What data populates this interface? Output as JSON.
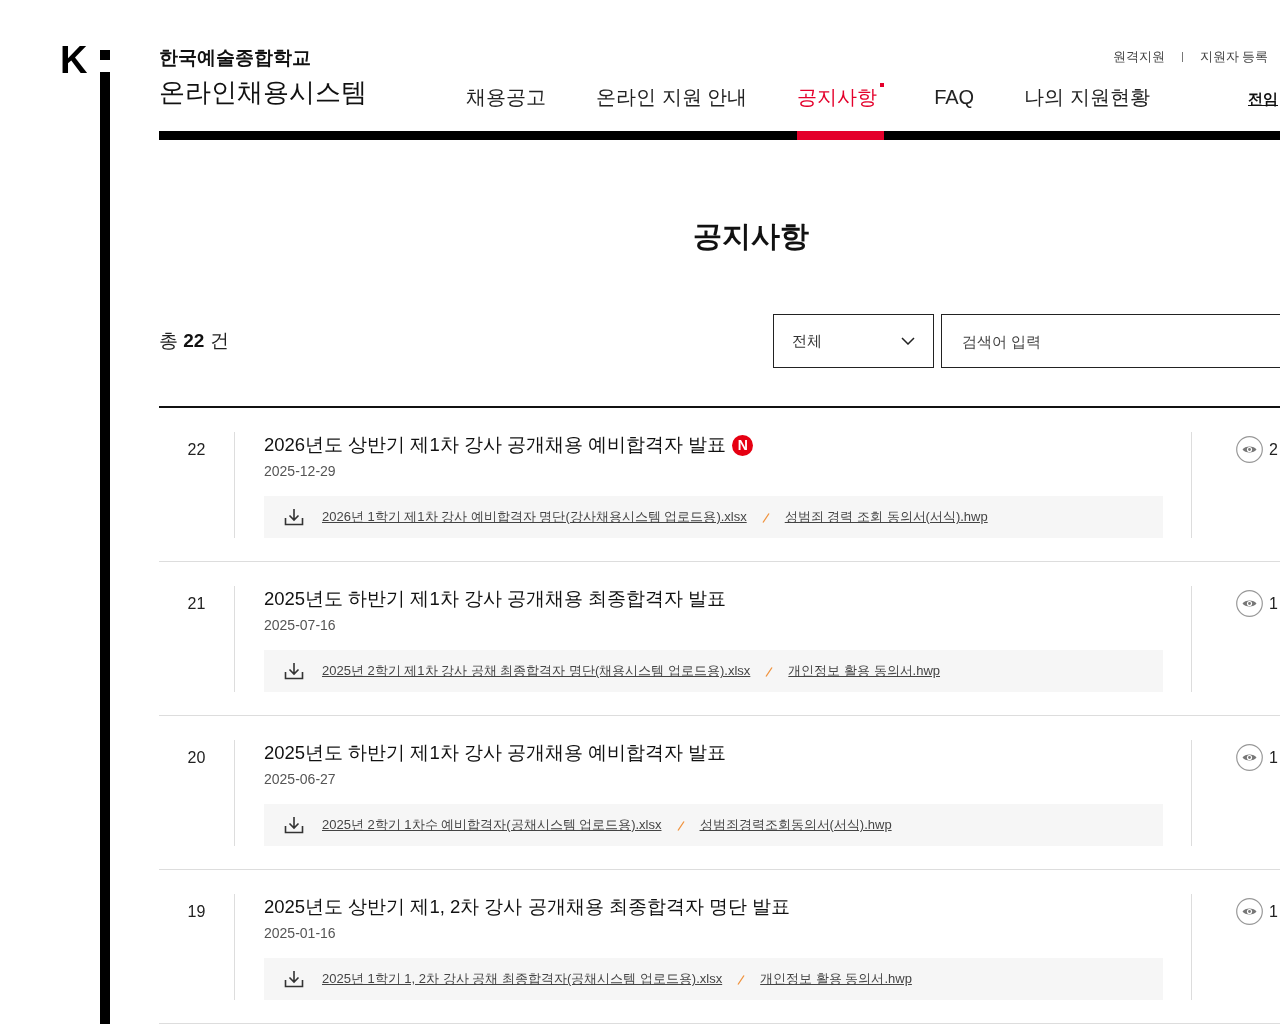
{
  "logo": {
    "mark": "K"
  },
  "brand": {
    "school": "한국예술종합학교",
    "system": "온라인채용시스템"
  },
  "utility_links": [
    "원격지원",
    "지원자 등록"
  ],
  "nav": [
    {
      "label": "채용공고",
      "kind": "menu",
      "selected": false
    },
    {
      "label": "온라인 지원 안내",
      "kind": "menu",
      "selected": false
    },
    {
      "label": "공지사항",
      "kind": "menu",
      "selected": true
    },
    {
      "label": "FAQ",
      "kind": "menu",
      "selected": false
    },
    {
      "label": "나의 지원현황",
      "kind": "menu",
      "selected": false
    },
    {
      "label": "전임",
      "kind": "link",
      "selected": false
    }
  ],
  "page_title": "공지사항",
  "board": {
    "total": "총 **22** 건",
    "filter": {
      "value": "전체"
    },
    "search": {
      "placeholder": "검색어 입력"
    },
    "new_badge": "N",
    "posts": [
      {
        "number": "22",
        "title": "2026년도 상반기 제1차 강사 공개채용 예비합격자 발표",
        "new": true,
        "date": "2025-12-29",
        "attachments": [
          "2026년 1학기 제1차 강사 예비합격자 명단(강사채용시스템 업로드용).xlsx",
          "성범죄 경력 조회 동의서(서식).hwp"
        ],
        "views": "2"
      },
      {
        "number": "21",
        "title": "2025년도 하반기 제1차 강사 공개채용 최종합격자 발표",
        "new": false,
        "date": "2025-07-16",
        "attachments": [
          "2025년 2학기 제1차 강사 공채 최종합격자 명단(채용시스템 업로드용).xlsx",
          "개인정보 활용 동의서.hwp"
        ],
        "views": "1"
      },
      {
        "number": "20",
        "title": "2025년도 하반기 제1차 강사 공개채용 예비합격자 발표",
        "new": false,
        "date": "2025-06-27",
        "attachments": [
          "2025년 2학기 1차수 예비합격자(공채시스템 업로드용).xlsx",
          "성범죄경력조회동의서(서식).hwp"
        ],
        "views": "1"
      },
      {
        "number": "19",
        "title": "2025년도 상반기 제1, 2차 강사 공개채용 최종합격자 명단 발표",
        "new": false,
        "date": "2025-01-16",
        "attachments": [
          "2025년 1학기 1, 2차 강사 공채 최종합격자(공채시스템 업로드용).xlsx",
          "개인정보 활용 동의서.hwp"
        ],
        "views": "1"
      }
    ]
  }
}
